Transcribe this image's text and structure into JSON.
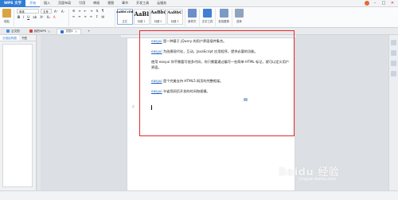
{
  "menubar": {
    "app_label": "WPS 文字",
    "items": [
      {
        "label": "开始",
        "active": true
      },
      {
        "label": "插入",
        "active": false
      },
      {
        "label": "页面布局",
        "active": false
      },
      {
        "label": "引用",
        "active": false
      },
      {
        "label": "审阅",
        "active": false
      },
      {
        "label": "视图",
        "active": false
      },
      {
        "label": "章节",
        "active": false
      },
      {
        "label": "开发工具",
        "active": false
      },
      {
        "label": "云服务",
        "active": false
      }
    ]
  },
  "ribbon": {
    "paste_label": "粘贴",
    "font_name": "宋体",
    "font_size": "五号",
    "styles": [
      {
        "sample": "AaBbCcDd",
        "name": "正文"
      },
      {
        "sample": "AaBl",
        "name": "标题 1"
      },
      {
        "sample": "AaBb(",
        "name": "标题 2"
      },
      {
        "sample": "AaBbC",
        "name": "标题 3"
      }
    ],
    "new_style_label": "新样式",
    "text_tools_label": "文字工具",
    "find_replace_label": "查找替换",
    "select_label": "选择"
  },
  "tabs": [
    {
      "label": "云文档",
      "active": false
    },
    {
      "label": "我的WPS",
      "active": false
    },
    {
      "label": "文档1",
      "active": true
    }
  ],
  "navpane": {
    "tabs": [
      {
        "label": "文档结构图"
      },
      {
        "label": "书签"
      }
    ]
  },
  "document": {
    "paragraphs": [
      {
        "kw": "easyui",
        "text": " 是一种基于 jQuery 的用户界面插件集合。"
      },
      {
        "kw": "easyui",
        "text": " 为创建现代化，互动，JavaScript 应用程序，提供必要的功能。"
      },
      {
        "kw": "",
        "text": "使用 easyui 你不需要写很多代码，你只需要通过编写一些简单 HTML 标记，就可以定义用户界面。"
      },
      {
        "kw": "easyui",
        "text": " 是个完美支持 HTML5 网页的完整框架。"
      },
      {
        "kw": "easyui",
        "text": " 节省您网页开发的时间和规模。"
      }
    ]
  },
  "statusbar": {
    "text": ""
  },
  "watermark": {
    "text": "Baidu 经验",
    "sub": "jingyan.baidu.com"
  }
}
